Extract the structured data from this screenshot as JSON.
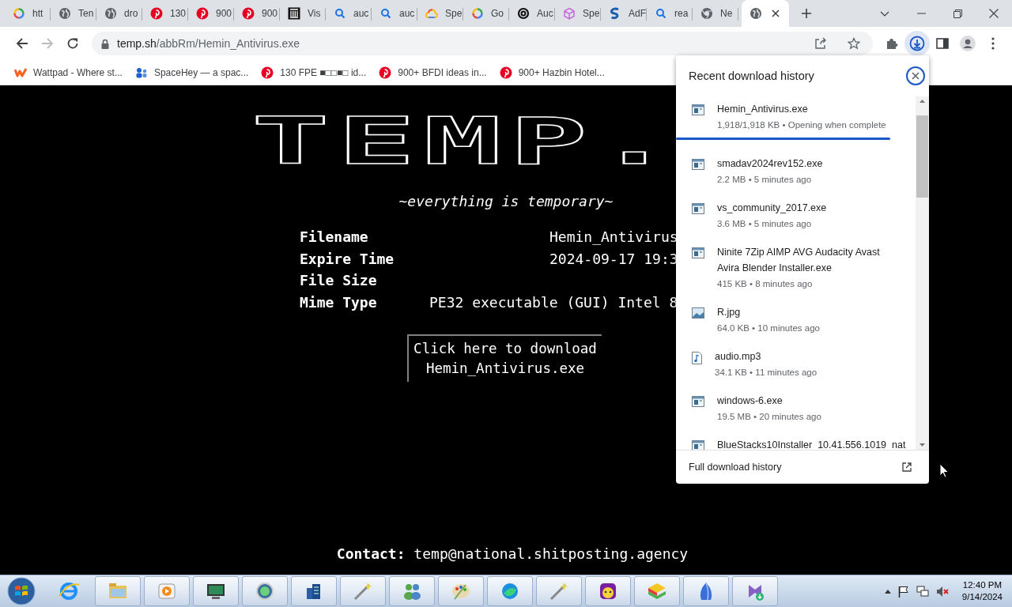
{
  "tabs": [
    {
      "label": "htt",
      "kind": "ring",
      "selected": false
    },
    {
      "label": "Ten",
      "kind": "globe",
      "selected": false
    },
    {
      "label": "dro",
      "kind": "globe",
      "selected": false
    },
    {
      "label": "130",
      "kind": "pin",
      "selected": false
    },
    {
      "label": "900",
      "kind": "pin",
      "selected": false
    },
    {
      "label": "900",
      "kind": "pin",
      "selected": false
    },
    {
      "label": "Vis",
      "kind": "columns",
      "selected": false
    },
    {
      "label": "auc",
      "kind": "search",
      "selected": false
    },
    {
      "label": "auc",
      "kind": "search",
      "selected": false
    },
    {
      "label": "Spe",
      "kind": "cloud",
      "selected": false
    },
    {
      "label": "Go",
      "kind": "ring",
      "selected": false
    },
    {
      "label": "Auc",
      "kind": "swirl",
      "selected": false
    },
    {
      "label": "Spe",
      "kind": "cube",
      "selected": false
    },
    {
      "label": "AdF",
      "kind": "s",
      "selected": false
    },
    {
      "label": "rea",
      "kind": "search",
      "selected": false
    },
    {
      "label": "Ne",
      "kind": "wheel",
      "selected": false
    },
    {
      "kind": "globe",
      "selected": true
    }
  ],
  "address": {
    "host": "temp.sh",
    "path": "/abbRm/Hemin_Antivirus.exe"
  },
  "bookmarks": [
    {
      "label": "Wattpad - Where st...",
      "kind": "w"
    },
    {
      "label": "SpaceHey — a spac...",
      "kind": "people"
    },
    {
      "label": "130 FPE ■□□■□ id...",
      "kind": "pin"
    },
    {
      "label": "900+ BFDI ideas in...",
      "kind": "pin"
    },
    {
      "label": "900+ Hazbin Hotel...",
      "kind": "pin"
    }
  ],
  "page": {
    "logo": "TEMP.",
    "tagline": "~everything is temporary~",
    "rows": [
      {
        "label": "Filename",
        "value": "Hemin_Antivirus"
      },
      {
        "label": "Expire Time",
        "value": "2024-09-17 19:3"
      },
      {
        "label": "File Size"
      },
      {
        "label": "Mime Type",
        "value": "PE32 executable (GUI) Intel 8"
      }
    ],
    "download": [
      "Click here to download",
      "Hemin_Antivirus.exe"
    ],
    "contact": "**Contact:** temp@national.shitposting.agency"
  },
  "downloads": {
    "title": "Recent download history",
    "items": [
      {
        "name": "Hemin_Antivirus.exe",
        "meta": "1,918/1,918 KB • Opening when complete",
        "kind": "exe",
        "level": 1
      },
      {
        "name": "smadav2024rev152.exe",
        "meta": "2.2 MB • 5 minutes ago",
        "kind": "exe"
      },
      {
        "name": "vs_community_2017.exe",
        "meta": "3.6 MB • 5 minutes ago",
        "kind": "exe"
      },
      {
        "name": "Ninite 7Zip AIMP AVG Audacity Avast Avira Blender Installer.exe",
        "meta": "415 KB • 8 minutes ago",
        "kind": "exe"
      },
      {
        "name": "R.jpg",
        "meta": "64.0 KB • 10 minutes ago",
        "kind": "image"
      },
      {
        "name": "audio.mp3",
        "meta": "34.1 KB • 11 minutes ago",
        "kind": "audio"
      },
      {
        "name": "windows-6.exe",
        "meta": "19.5 MB • 20 minutes ago",
        "kind": "exe"
      },
      {
        "name": "BlueStacks10Installer_10.41.556.1019_nat",
        "kind": "exe"
      }
    ],
    "footer": "Full download history"
  },
  "taskbar": {
    "time": "12:40 PM",
    "date": "9/14/2024"
  }
}
